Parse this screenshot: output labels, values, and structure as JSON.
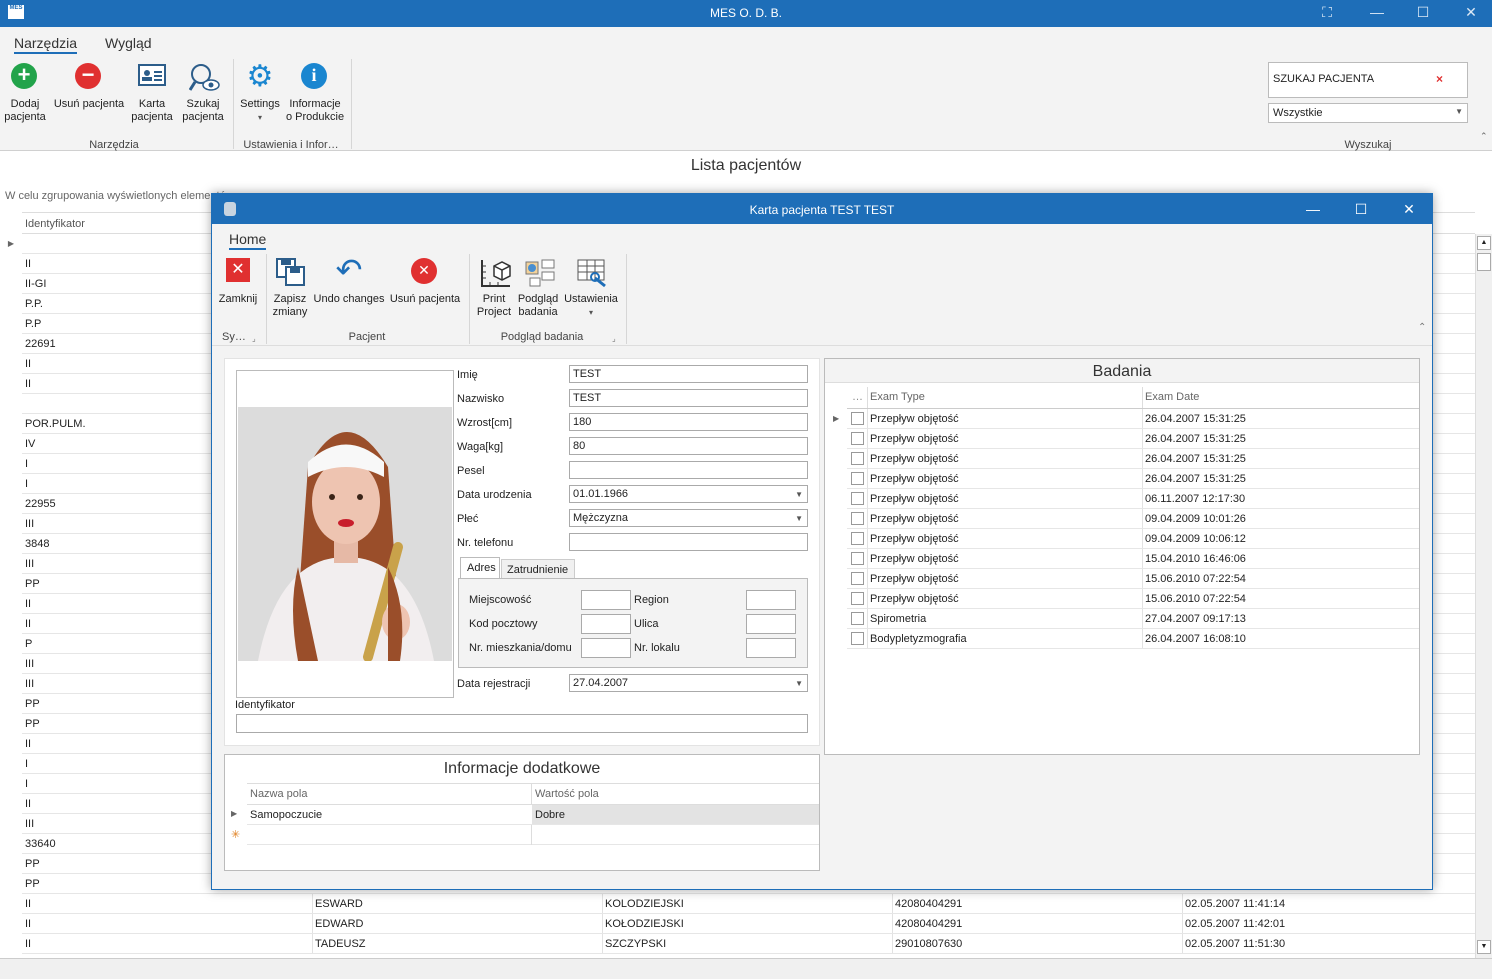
{
  "app": {
    "title": "MES O. D. B.",
    "logo_text": "MES"
  },
  "window_controls": {
    "fullscreen": "⛶",
    "minimize": "—",
    "maximize": "☐",
    "close": "✕"
  },
  "ribbon": {
    "tabs": [
      "Narzędzia",
      "Wygląd"
    ],
    "buttons": [
      {
        "label": "Dodaj\npacjenta"
      },
      {
        "label": "Usuń pacjenta"
      },
      {
        "label": "Karta\npacjenta"
      },
      {
        "label": "Szukaj\npacjenta"
      },
      {
        "label": "Settings"
      },
      {
        "label": "Informacje\no Produkcie"
      }
    ],
    "groups": [
      "Narzędzia",
      "Ustawienia i Infor…",
      "Wyszukaj"
    ],
    "search": {
      "value": "SZUKAJ PACJENTA",
      "clear": "×"
    },
    "filter": {
      "value": "Wszystkie"
    }
  },
  "list": {
    "title": "Lista pacjentów",
    "group_hint": "W celu zgrupowania wyświetlonych elementów",
    "header": "Identyfikator",
    "rows": [
      {
        "id": ""
      },
      {
        "id": "II"
      },
      {
        "id": "II-GI"
      },
      {
        "id": "P.P."
      },
      {
        "id": "P.P"
      },
      {
        "id": "22691"
      },
      {
        "id": "II"
      },
      {
        "id": "II"
      },
      {
        "id": ""
      },
      {
        "id": "POR.PULM."
      },
      {
        "id": "IV"
      },
      {
        "id": "I"
      },
      {
        "id": "I"
      },
      {
        "id": "22955"
      },
      {
        "id": "III"
      },
      {
        "id": "3848"
      },
      {
        "id": "III"
      },
      {
        "id": "PP"
      },
      {
        "id": "II"
      },
      {
        "id": "II"
      },
      {
        "id": "P"
      },
      {
        "id": "III"
      },
      {
        "id": "III"
      },
      {
        "id": "PP"
      },
      {
        "id": "PP"
      },
      {
        "id": "II"
      },
      {
        "id": "I"
      },
      {
        "id": "I"
      },
      {
        "id": "II"
      },
      {
        "id": "III"
      },
      {
        "id": "33640"
      },
      {
        "id": "PP"
      },
      {
        "id": "PP"
      },
      {
        "id": "II",
        "first": "ESWARD",
        "last": "KOLODZIEJSKI",
        "pesel": "42080404291",
        "date": "02.05.2007 11:41:14"
      },
      {
        "id": "II",
        "first": "EDWARD",
        "last": "KOŁODZIEJSKI",
        "pesel": "42080404291",
        "date": "02.05.2007 11:42:01"
      },
      {
        "id": "II",
        "first": "TADEUSZ",
        "last": "SZCZYPSKI",
        "pesel": "29010807630",
        "date": "02.05.2007 11:51:30"
      }
    ]
  },
  "dialog": {
    "title": "Karta pacjenta TEST TEST",
    "tab": "Home",
    "buttons": [
      {
        "label": "Zamknij"
      },
      {
        "label": "Zapisz\nzmiany"
      },
      {
        "label": "Undo changes"
      },
      {
        "label": "Usuń pacjenta"
      },
      {
        "label": "Print\nProject"
      },
      {
        "label": "Podgląd\nbadania"
      },
      {
        "label": "Ustawienia"
      }
    ],
    "groups": [
      "Sy…",
      "Pacjent",
      "Podgląd badania"
    ],
    "form": {
      "imie_label": "Imię",
      "imie": "TEST",
      "nazwisko_label": "Nazwisko",
      "nazwisko": "TEST",
      "wzrost_label": "Wzrost[cm]",
      "wzrost": "180",
      "waga_label": "Waga[kg]",
      "waga": "80",
      "pesel_label": "Pesel",
      "pesel": "",
      "data_ur_label": "Data urodzenia",
      "data_ur": "01.01.1966",
      "plec_label": "Płeć",
      "plec": "Mężczyzna",
      "telefon_label": "Nr. telefonu",
      "telefon": "",
      "tabs": [
        "Adres",
        "Zatrudnienie"
      ],
      "miejscowosc_label": "Miejscowość",
      "region_label": "Region",
      "kod_label": "Kod pocztowy",
      "ulica_label": "Ulica",
      "nr_mieszkania_label": "Nr. mieszkania/domu",
      "nr_lokalu_label": "Nr. lokalu",
      "data_rej_label": "Data rejestracji",
      "data_rej": "27.04.2007",
      "identyfikator_label": "Identyfikator",
      "identyfikator": ""
    },
    "extra": {
      "title": "Informacje dodatkowe",
      "col1": "Nazwa pola",
      "col2": "Wartość pola",
      "rows": [
        {
          "name": "Samopoczucie",
          "value": "Dobre"
        }
      ]
    },
    "exams": {
      "title": "Badania",
      "col0": "…",
      "col1": "Exam Type",
      "col2": "Exam Date",
      "rows": [
        {
          "type": "Przepływ objętość",
          "date": "26.04.2007 15:31:25"
        },
        {
          "type": "Przepływ objętość",
          "date": "26.04.2007 15:31:25"
        },
        {
          "type": "Przepływ objętość",
          "date": "26.04.2007 15:31:25"
        },
        {
          "type": "Przepływ objętość",
          "date": "26.04.2007 15:31:25"
        },
        {
          "type": "Przepływ objętość",
          "date": "06.11.2007 12:17:30"
        },
        {
          "type": "Przepływ objętość",
          "date": "09.04.2009 10:01:26"
        },
        {
          "type": "Przepływ objętość",
          "date": "09.04.2009 10:06:12"
        },
        {
          "type": "Przepływ objętość",
          "date": "15.04.2010 16:46:06"
        },
        {
          "type": "Przepływ objętość",
          "date": "15.06.2010 07:22:54"
        },
        {
          "type": "Przepływ objętość",
          "date": "15.06.2010 07:22:54"
        },
        {
          "type": "Spirometria",
          "date": "27.04.2007 09:17:13"
        },
        {
          "type": "Bodypletyzmografia",
          "date": "26.04.2007 16:08:10"
        }
      ]
    }
  },
  "colors": {
    "accent": "#1e6eb8",
    "add": "#22a34a",
    "remove": "#e03030",
    "info": "#1a86d0"
  }
}
